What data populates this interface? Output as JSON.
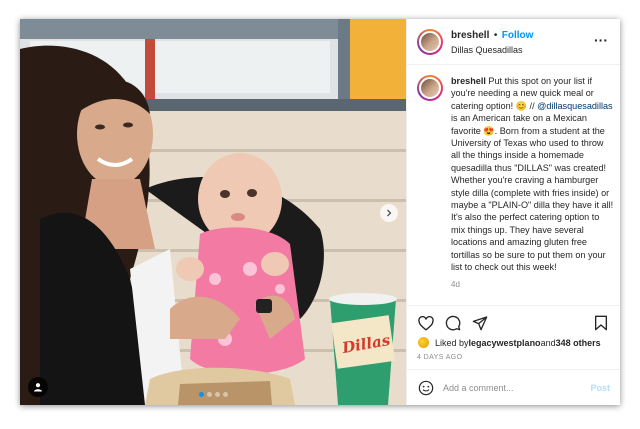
{
  "post": {
    "username": "breshell",
    "separator": "•",
    "follow_label": "Follow",
    "location": "Dillas Quesadillas",
    "more_icon": "more-horizontal-icon",
    "more_label": "···"
  },
  "caption": {
    "username": "breshell",
    "part1": " Put this spot on your list if you're needing a new quick meal or catering option! 😊 // ",
    "mention": "@dillasquesadillas",
    "part2": " is an American take on a Mexican favorite 😍. Born from a student at the University of Texas who used to throw all the things inside a homemade quesadilla thus \"DILLAS\" was created! Whether you're craving a hamburger style dilla (complete with fries inside) or maybe a \"PLAIN-O\" dilla they have it all! It's also the perfect catering option to mix things up. They have several locations and amazing gluten free tortillas so be sure to put them on your list to check out this week!",
    "time": "4d"
  },
  "likes": {
    "prefix": "Liked by ",
    "user": "legacywestplano",
    "middle": " and ",
    "others": "348 others"
  },
  "date": "4 DAYS AGO",
  "comment": {
    "placeholder": "Add a comment...",
    "post_label": "Post"
  },
  "photo": {
    "cup_text": "Dillas",
    "carousel_count": 4,
    "carousel_active": 0
  },
  "colors": {
    "accent": "#0095f6",
    "post_disabled": "#b2dffc",
    "mention": "#00376b"
  },
  "icons": [
    "heart-icon",
    "comment-icon",
    "share-icon",
    "bookmark-icon",
    "emoji-icon",
    "tag-user-icon",
    "chevron-right-icon"
  ]
}
